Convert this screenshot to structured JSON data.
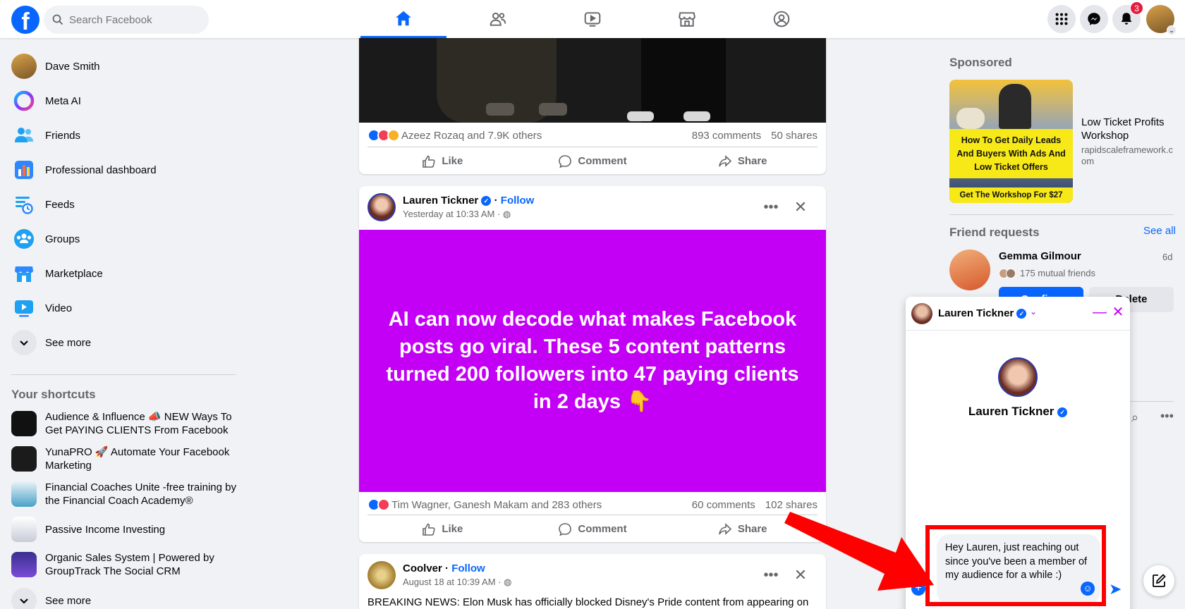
{
  "search": {
    "placeholder": "Search Facebook"
  },
  "logo_letter": "f",
  "notifications_count": "3",
  "left_nav": [
    {
      "label": "Dave Smith"
    },
    {
      "label": "Meta AI"
    },
    {
      "label": "Friends"
    },
    {
      "label": "Professional dashboard"
    },
    {
      "label": "Feeds"
    },
    {
      "label": "Groups"
    },
    {
      "label": "Marketplace"
    },
    {
      "label": "Video"
    },
    {
      "label": "See more"
    }
  ],
  "shortcuts": {
    "title": "Your shortcuts",
    "items": [
      {
        "label": "Audience & Influence 📣 NEW Ways To Get PAYING CLIENTS From Facebook"
      },
      {
        "label": "YunaPRO 🚀 Automate Your Facebook Marketing"
      },
      {
        "label": "Financial Coaches Unite -free training by the Financial Coach Academy®"
      },
      {
        "label": "Passive Income Investing"
      },
      {
        "label": "Organic Sales System | Powered by GroupTrack The Social CRM"
      }
    ],
    "see_more": "See more"
  },
  "posts": [
    {
      "reactions_text": "Azeez Rozaq and 7.9K others",
      "comments": "893 comments",
      "shares": "50 shares"
    },
    {
      "author": "Lauren Tickner",
      "follow": "Follow",
      "separator": " · ",
      "time": "Yesterday at 10:33 AM · ",
      "body": "AI can now decode what makes Facebook posts go viral. These 5 content patterns turned 200 followers into 47 paying clients in 2 days 👇",
      "reactions_text": "Tim Wagner, Ganesh Makam and 283 others",
      "comments": "60 comments",
      "shares": "102 shares"
    },
    {
      "author": "Coolver",
      "follow": "Follow",
      "separator": " · ",
      "time": "August 18 at 10:39 AM · ",
      "body": "BREAKING NEWS: Elon Musk has officially blocked Disney's Pride content from appearing on"
    }
  ],
  "actions": {
    "like": "Like",
    "comment": "Comment",
    "share": "Share"
  },
  "sponsored": {
    "title": "Sponsored",
    "ad_headline": "How To Get Daily Leads And Buyers With Ads And Low Ticket Offers",
    "ad_cta": "Get The Workshop For $27",
    "ad_title": "Low Ticket Profits Workshop",
    "ad_url": "rapidscaleframework.com"
  },
  "friend_requests": {
    "title": "Friend requests",
    "see_all": "See all",
    "name": "Gemma Gilmour",
    "time": "6d",
    "mutual": "175 mutual friends",
    "confirm": "Confirm",
    "delete": "Delete"
  },
  "chat": {
    "name": "Lauren Tickner",
    "draft": "Hey Lauren, just reaching out since you've been a member of my audience for a while :)"
  },
  "colors": {
    "brand": "#0866ff",
    "post_background": "#c300f5",
    "annotation": "#ff0000"
  }
}
